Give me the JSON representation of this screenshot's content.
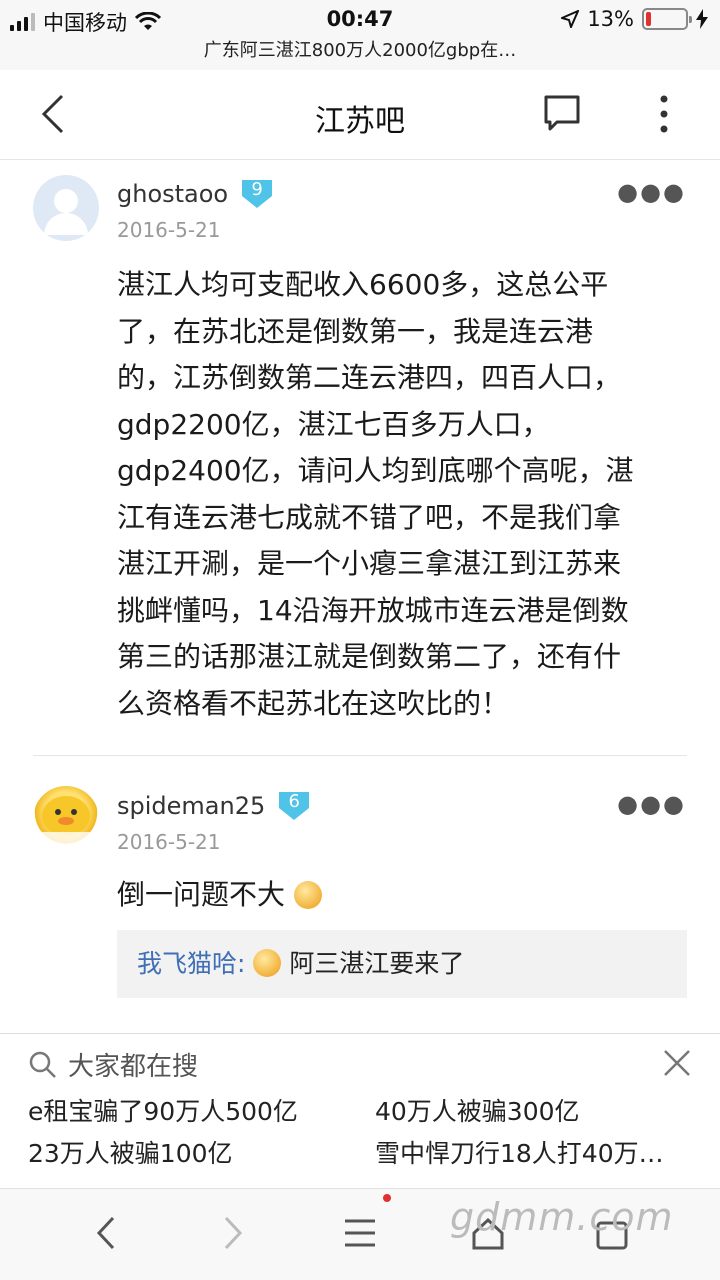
{
  "status_bar": {
    "carrier": "中国移动",
    "time": "00:47",
    "battery": "13%",
    "battery_level": 0.13
  },
  "url_title": "广东阿三湛江800万人2000亿gbp在…",
  "header": {
    "title": "江苏吧"
  },
  "posts": [
    {
      "username": "ghostaoo",
      "level": "9",
      "date": "2016-5-21",
      "lines": [
        "湛江人均可支配收入6600多，这总公平",
        "了，在苏北还是倒数第一，我是连云港",
        "的，江苏倒数第二连云港四，四百人口，",
        "gdp2200亿，湛江七百多万人口，",
        "gdp2400亿，请问人均到底哪个高呢，湛",
        "江有连云港七成就不错了吧，不是我们拿",
        "湛江开涮，是一个小瘪三拿湛江到江苏来",
        "挑衅懂吗，14沿海开放城市连云港是倒数",
        "第三的话那湛江就是倒数第二了，还有什",
        "么资格看不起苏北在这吹比的！"
      ]
    },
    {
      "username": "spideman25",
      "level": "6",
      "date": "2016-5-21",
      "text": "倒一问题不大",
      "reply": {
        "name": "我飞猫哈:",
        "text": "阿三湛江要来了"
      }
    }
  ],
  "search_panel": {
    "heading": "大家都在搜",
    "items": [
      "e租宝骗了90万人500亿",
      "40万人被骗300亿",
      "23万人被骗100亿",
      "雪中悍刀行18人打40万…"
    ]
  },
  "watermark": "gdmm.com",
  "colors": {
    "level_badge": "#4fc3e8",
    "reply_name": "#3f6fb4",
    "battery_low": "#e03030"
  }
}
